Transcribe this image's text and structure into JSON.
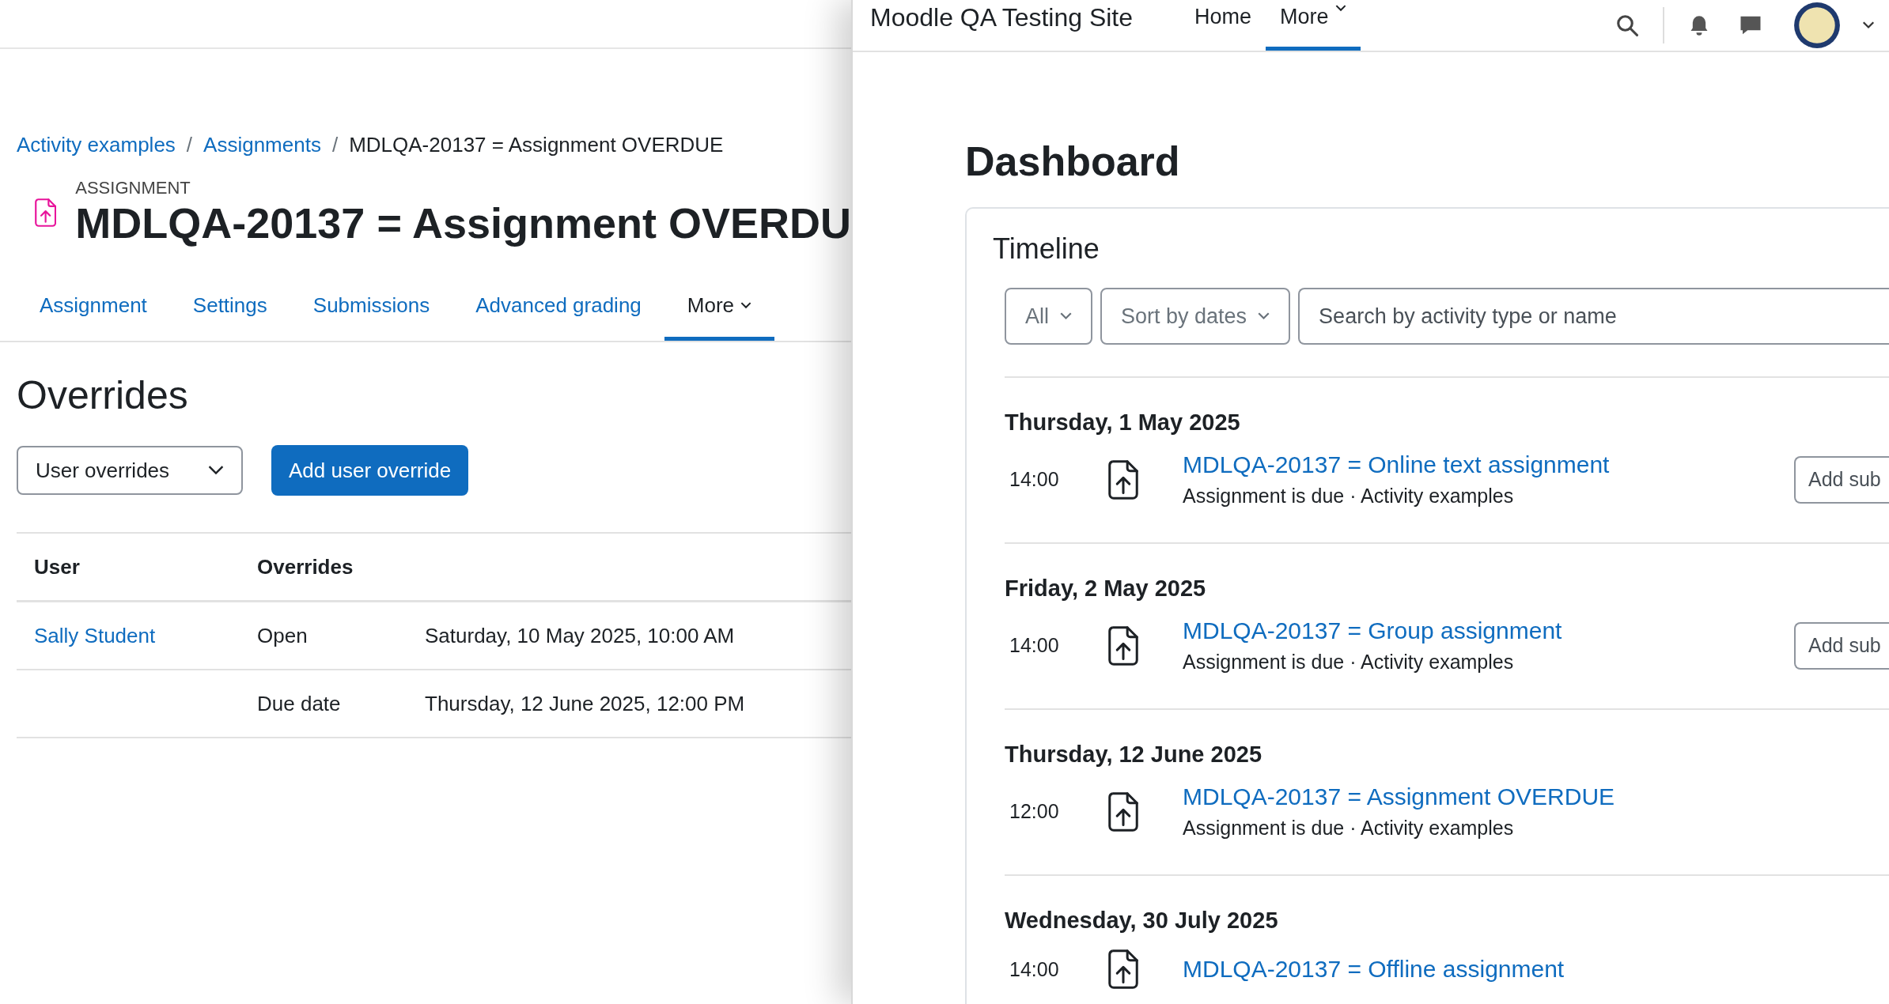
{
  "assignment_page": {
    "breadcrumb": [
      {
        "kind": "link",
        "label": "Activity examples"
      },
      {
        "kind": "separator",
        "label": "/"
      },
      {
        "kind": "link",
        "label": "Assignments"
      },
      {
        "kind": "separator",
        "label": "/"
      },
      {
        "kind": "current",
        "label": "MDLQA-20137 = Assignment OVERDUE"
      }
    ],
    "activity_type": "ASSIGNMENT",
    "title": "MDLQA-20137 = Assignment OVERDU",
    "tabs": [
      {
        "label": "Assignment",
        "selected": false,
        "dropdown": false
      },
      {
        "label": "Settings",
        "selected": false,
        "dropdown": false
      },
      {
        "label": "Submissions",
        "selected": false,
        "dropdown": false
      },
      {
        "label": "Advanced grading",
        "selected": false,
        "dropdown": false
      },
      {
        "label": "More",
        "selected": true,
        "dropdown": true
      }
    ],
    "heading": "Overrides",
    "override_select": "User overrides",
    "add_button": "Add user override",
    "table": {
      "columns": [
        "User",
        "Overrides"
      ],
      "rows": [
        {
          "user": "Sally Student",
          "setting": "Open",
          "value": "Saturday, 10 May 2025, 10:00 AM"
        },
        {
          "setting": "Due date",
          "value": "Thursday, 12 June 2025, 12:00 PM"
        }
      ]
    }
  },
  "dashboard_window": {
    "site_name": "Moodle QA Testing Site",
    "nav": [
      {
        "label": "Home",
        "selected": false,
        "dropdown": false
      },
      {
        "label": "More",
        "selected": true,
        "dropdown": true
      }
    ],
    "heading": "Dashboard",
    "timeline": {
      "title": "Timeline",
      "filters": [
        {
          "label": "All"
        },
        {
          "label": "Sort by dates"
        }
      ],
      "search": {
        "placeholder": "Search by activity type or name"
      },
      "groups": [
        {
          "date": "Thursday, 1 May 2025",
          "items": [
            {
              "time": "14:00",
              "title": "MDLQA-20137 = Online text assignment",
              "meta": "Assignment is due · Activity examples",
              "action": "Add sub"
            }
          ]
        },
        {
          "date": "Friday, 2 May 2025",
          "items": [
            {
              "time": "14:00",
              "title": "MDLQA-20137 = Group assignment",
              "meta": "Assignment is due · Activity examples",
              "action": "Add sub"
            }
          ]
        },
        {
          "date": "Thursday, 12 June 2025",
          "items": [
            {
              "time": "12:00",
              "title": "MDLQA-20137 = Assignment OVERDUE",
              "meta": "Assignment is due · Activity examples"
            }
          ]
        },
        {
          "date": "Wednesday, 30 July 2025",
          "items": [
            {
              "time": "14:00",
              "title": "MDLQA-20137 = Offline assignment"
            }
          ]
        }
      ]
    }
  }
}
